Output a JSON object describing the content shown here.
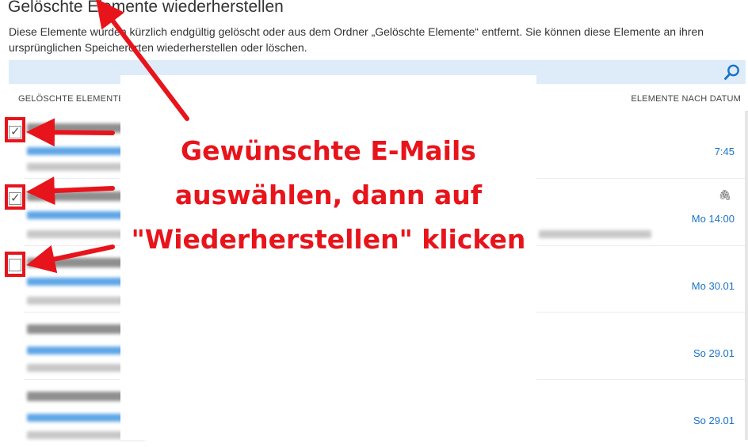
{
  "page": {
    "title": "Gelöschte Elemente wiederherstellen",
    "description": "Diese Elemente wurden kürzlich endgültig gelöscht oder aus dem Ordner „Gelöschte Elemente“ entfernt. Sie können diese Elemente an ihren ursprünglichen Speicherorten wiederherstellen oder löschen."
  },
  "search": {
    "icon": "search-icon"
  },
  "list_header": {
    "left": "GELÖSCHTE ELEMENTE",
    "right": "ELEMENTE NACH DATUM"
  },
  "rows": [
    {
      "checked": true,
      "date": "7:45",
      "attachment": false
    },
    {
      "checked": true,
      "date": "Mo 14:00",
      "attachment": true
    },
    {
      "checked": false,
      "date": "Mo 30.01",
      "attachment": false
    },
    {
      "checked": false,
      "date": "So 29.01",
      "attachment": false
    },
    {
      "checked": false,
      "date": "So 29.01",
      "attachment": false
    }
  ],
  "annotation": {
    "line1": "Gewünschte E-Mails",
    "line2": "auswählen, dann auf",
    "line3": "\"Wiederherstellen\" klicken",
    "color": "#e8141b"
  },
  "colors": {
    "accent": "#1a73c8",
    "search_bg": "#deecf9",
    "annotation_red": "#e8141b"
  }
}
